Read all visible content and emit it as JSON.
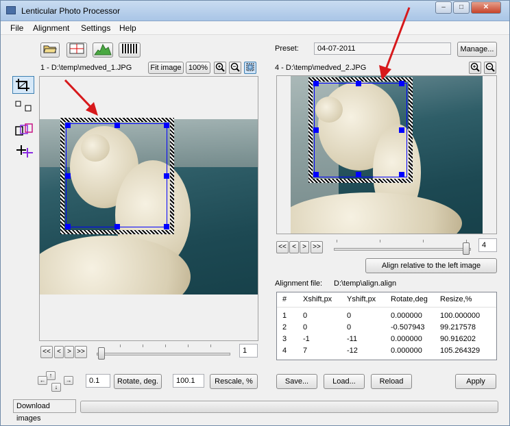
{
  "window": {
    "title": "Lenticular Photo Processor",
    "minimize": "‒",
    "maximize": "□",
    "close": "✕"
  },
  "menu": [
    "File",
    "Alignment",
    "Settings",
    "Help"
  ],
  "left": {
    "image_label": "1 - D:\\temp\\medved_1.JPG",
    "fit_image": "Fit image",
    "zoom_100": "100%",
    "nav": [
      "<<",
      "<",
      ">",
      ">>"
    ],
    "frame_value": "1",
    "rotate_value": "0.1",
    "rotate_button": "Rotate, deg.",
    "rescale_value": "100.1",
    "rescale_button": "Rescale, %"
  },
  "right": {
    "preset_label": "Preset:",
    "preset_value": "04-07-2011",
    "manage": "Manage...",
    "image_label": "4 - D:\\temp\\medved_2.JPG",
    "nav": [
      "<<",
      "<",
      ">",
      ">>"
    ],
    "frame_value": "4",
    "align_button": "Align relative to the left image",
    "alignment_file_label": "Alignment file:",
    "alignment_file_value": "D:\\temp\\align.align",
    "table": {
      "headers": [
        "#",
        "Xshift,px",
        "Yshift,px",
        "Rotate,deg",
        "Resize,%"
      ],
      "rows": [
        [
          "1",
          "0",
          "0",
          "0.000000",
          "100.000000"
        ],
        [
          "2",
          "0",
          "0",
          "-0.507943",
          "99.217578"
        ],
        [
          "3",
          "-1",
          "-11",
          "0.000000",
          "90.916202"
        ],
        [
          "4",
          "7",
          "-12",
          "0.000000",
          "105.264329"
        ]
      ]
    },
    "save": "Save...",
    "load": "Load...",
    "reload": "Reload",
    "apply": "Apply"
  },
  "status": {
    "download": "Download images"
  },
  "colors": {
    "selection_handle": "#0000ff",
    "annotation_arrow": "#d7191c"
  }
}
